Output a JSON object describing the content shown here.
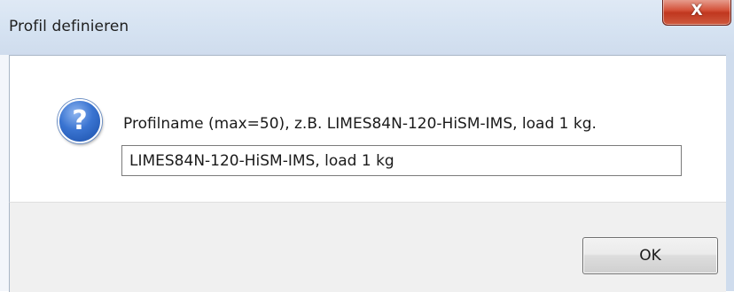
{
  "window": {
    "title": "Profil definieren",
    "close_symbol": "X"
  },
  "icons": {
    "question": "question-icon",
    "question_glyph": "?"
  },
  "prompt": {
    "label": "Profilname (max=50), z.B. LIMES84N-120-HiSM-IMS, load 1 kg.",
    "input_value": "LIMES84N-120-HiSM-IMS, load 1 kg"
  },
  "buttons": {
    "ok_label": "OK"
  },
  "colors": {
    "titlebar": "#d6e3f2",
    "close_button": "#c0371f",
    "client_background": "#ffffff",
    "button_area": "#f0f0f0",
    "question_icon": "#3a74d1"
  }
}
